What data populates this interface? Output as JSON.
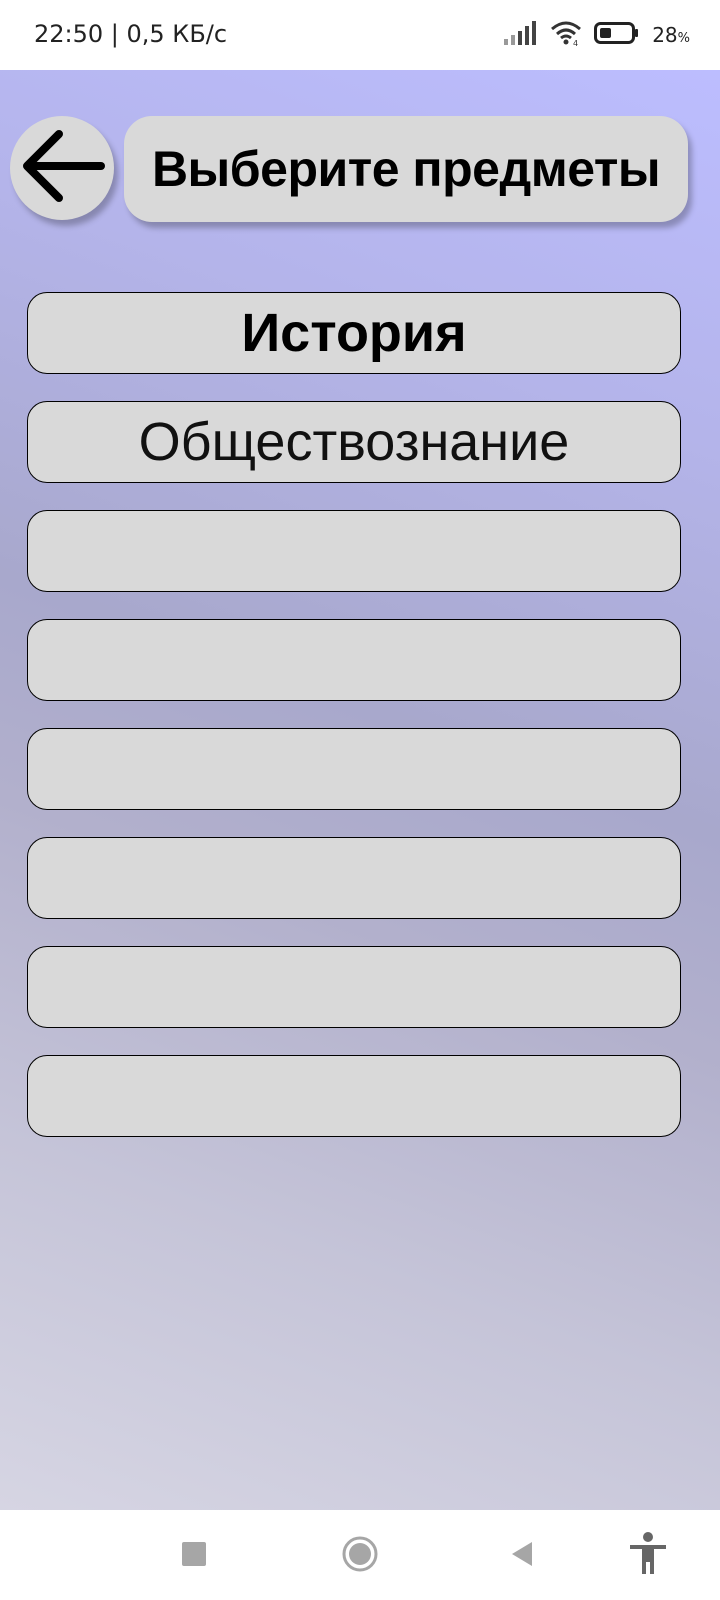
{
  "status_bar": {
    "time_speed": "22:50 | 0,5 КБ/с",
    "battery": "28",
    "battery_unit": "%"
  },
  "header": {
    "title": "Выберите предметы",
    "back_icon": "arrow-left-icon"
  },
  "subjects": [
    {
      "label": "История",
      "selected": true
    },
    {
      "label": "Обществознание",
      "selected": false
    },
    {
      "label": ""
    },
    {
      "label": ""
    },
    {
      "label": ""
    },
    {
      "label": ""
    },
    {
      "label": ""
    },
    {
      "label": ""
    }
  ],
  "nav_bar": {
    "icons": [
      "square-icon",
      "home-circle-icon",
      "back-triangle-icon",
      "accessibility-icon"
    ]
  },
  "colors": {
    "button_fill": "#d9d9d9",
    "gradient_top": "#bcbdff",
    "gradient_bottom": "#d6d5e3"
  }
}
